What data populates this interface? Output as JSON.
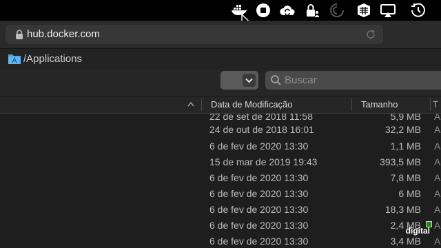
{
  "menubar": {
    "icons": [
      "docker-whale-icon",
      "stop-icon",
      "cloud-sync-icon",
      "lock-user-icon",
      "sound-waves-icon",
      "grid-globe-icon",
      "airplay-icon",
      "time-machine-icon"
    ]
  },
  "browser": {
    "url": "hub.docker.com"
  },
  "finder": {
    "path": "/Applications",
    "search_placeholder": "Buscar",
    "columns": {
      "date": "Data de Modificação",
      "size": "Tamanho",
      "kind": "T"
    },
    "rows": [
      {
        "date": "22 de set de 2018 11:58",
        "size": "5,9 MB",
        "kind": "A"
      },
      {
        "date": "24 de out de 2018 16:01",
        "size": "32,2 MB",
        "kind": "A"
      },
      {
        "date": "6 de fev de 2020 13:30",
        "size": "1,1 MB",
        "kind": "A"
      },
      {
        "date": "15 de mar de 2019 19:43",
        "size": "393,5 MB",
        "kind": "A"
      },
      {
        "date": "6 de fev de 2020 13:30",
        "size": "7,8 MB",
        "kind": "A"
      },
      {
        "date": "6 de fev de 2020 13:30",
        "size": "6 MB",
        "kind": "A"
      },
      {
        "date": "6 de fev de 2020 13:30",
        "size": "18,3 MB",
        "kind": "A"
      },
      {
        "date": "6 de fev de 2020 13:30",
        "size": "2,4 MB",
        "kind": "A"
      },
      {
        "date": "6 de fev de 2020 13:30",
        "size": "3,4 MB",
        "kind": "A"
      }
    ]
  },
  "watermark": "digital"
}
